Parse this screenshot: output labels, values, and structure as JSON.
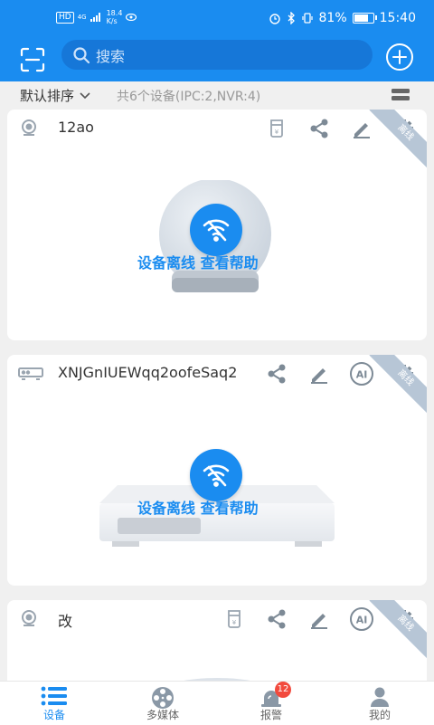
{
  "status_bar": {
    "hd": "HD",
    "net_type": "4G",
    "speed_value": "18.4",
    "speed_unit": "K/s",
    "battery": "81%",
    "time": "15:40"
  },
  "search": {
    "placeholder": "搜索"
  },
  "sort_bar": {
    "sort_label": "默认排序",
    "device_count": "共6个设备(IPC:2,NVR:4)"
  },
  "devices": [
    {
      "name": "12ao",
      "type": "camera",
      "status": "离线",
      "offline_text": "设备离线",
      "help_text": "查看帮助"
    },
    {
      "name": "XNJGnIUEWqq2oofeSaq2",
      "type": "nvr",
      "status": "离线",
      "offline_text": "设备离线",
      "help_text": "查看帮助"
    },
    {
      "name": "改",
      "type": "camera",
      "status": "离线"
    }
  ],
  "ai_label": "AI",
  "tabs": [
    {
      "label": "设备",
      "active": true
    },
    {
      "label": "多媒体"
    },
    {
      "label": "报警",
      "badge": "12"
    },
    {
      "label": "我的"
    }
  ],
  "colors": {
    "primary": "#1a8cf0",
    "ribbon": "#b7c6d6",
    "badge": "#f24a3d"
  }
}
